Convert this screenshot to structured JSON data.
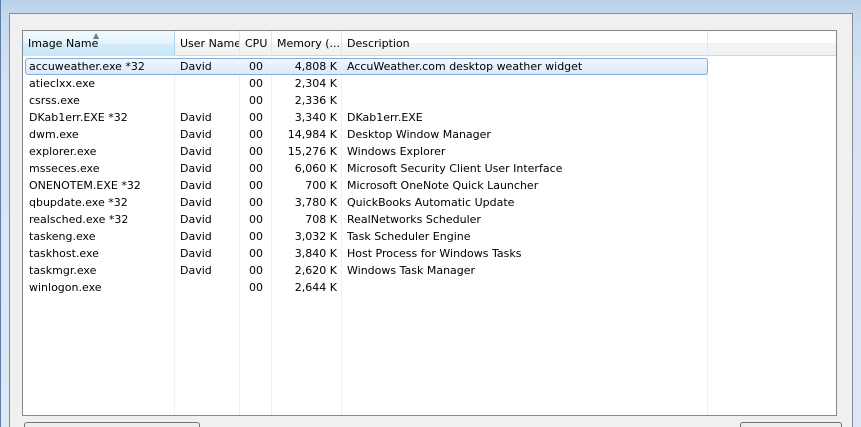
{
  "list": {
    "columns": [
      {
        "label": "Image Name"
      },
      {
        "label": "User Name"
      },
      {
        "label": "CPU"
      },
      {
        "label": "Memory (..."
      },
      {
        "label": "Description"
      }
    ],
    "sorted_column": "Image Name",
    "sort_direction": "ascending",
    "selected_row": 0,
    "rows": [
      {
        "name": "accuweather.exe *32",
        "user": "David",
        "cpu": "00",
        "mem": "4,808 K",
        "desc": "AccuWeather.com desktop weather widget"
      },
      {
        "name": "atieclxx.exe",
        "user": "",
        "cpu": "00",
        "mem": "2,304 K",
        "desc": ""
      },
      {
        "name": "csrss.exe",
        "user": "",
        "cpu": "00",
        "mem": "2,336 K",
        "desc": ""
      },
      {
        "name": "DKab1err.EXE *32",
        "user": "David",
        "cpu": "00",
        "mem": "3,340 K",
        "desc": "DKab1err.EXE"
      },
      {
        "name": "dwm.exe",
        "user": "David",
        "cpu": "00",
        "mem": "14,984 K",
        "desc": "Desktop Window Manager"
      },
      {
        "name": "explorer.exe",
        "user": "David",
        "cpu": "00",
        "mem": "15,276 K",
        "desc": "Windows Explorer"
      },
      {
        "name": "msseces.exe",
        "user": "David",
        "cpu": "00",
        "mem": "6,060 K",
        "desc": "Microsoft Security Client User Interface"
      },
      {
        "name": "ONENOTEM.EXE *32",
        "user": "David",
        "cpu": "00",
        "mem": "700 K",
        "desc": "Microsoft OneNote Quick Launcher"
      },
      {
        "name": "qbupdate.exe *32",
        "user": "David",
        "cpu": "00",
        "mem": "3,780 K",
        "desc": "QuickBooks Automatic Update"
      },
      {
        "name": "realsched.exe *32",
        "user": "David",
        "cpu": "00",
        "mem": "708 K",
        "desc": "RealNetworks Scheduler"
      },
      {
        "name": "taskeng.exe",
        "user": "David",
        "cpu": "00",
        "mem": "3,032 K",
        "desc": "Task Scheduler Engine"
      },
      {
        "name": "taskhost.exe",
        "user": "David",
        "cpu": "00",
        "mem": "3,840 K",
        "desc": "Host Process for Windows Tasks"
      },
      {
        "name": "taskmgr.exe",
        "user": "David",
        "cpu": "00",
        "mem": "2,620 K",
        "desc": "Windows Task Manager"
      },
      {
        "name": "winlogon.exe",
        "user": "",
        "cpu": "00",
        "mem": "2,644 K",
        "desc": ""
      }
    ]
  },
  "colors": {
    "selection_border": "#84acdd",
    "selection_fill": "#dbeafa",
    "sorted_header": "#d4ecf9"
  }
}
